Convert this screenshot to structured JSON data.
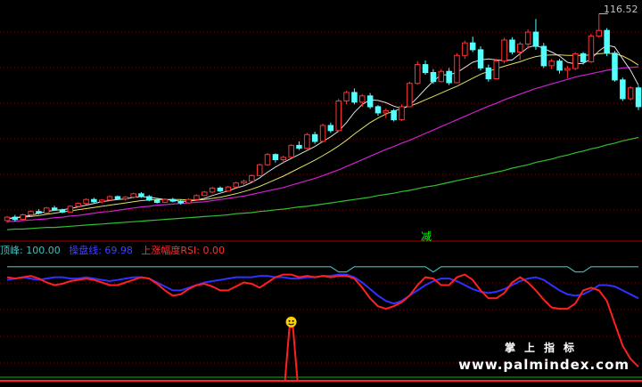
{
  "price_label": "116.52",
  "signal_label": "减",
  "legend": [
    {
      "text": "顶峰: 100.00",
      "color": "#40c0c0"
    },
    {
      "text": "操盘线: 69.98",
      "color": "#4040ff"
    },
    {
      "text": "上涨幅度RSI: 0.00",
      "color": "#ff3030"
    }
  ],
  "watermark": {
    "cn": "掌上指标",
    "url": "www.palmindex.com"
  },
  "chart_data": {
    "type": "candlestick",
    "upper": {
      "ylim": [
        78,
        118
      ],
      "price_marker": 116.52,
      "candles": [
        [
          80.2,
          81.0,
          79.8,
          80.8
        ],
        [
          80.8,
          81.2,
          80.0,
          80.4
        ],
        [
          80.4,
          81.4,
          80.2,
          81.2
        ],
        [
          81.2,
          82.0,
          80.9,
          81.8
        ],
        [
          81.8,
          82.2,
          81.3,
          81.5
        ],
        [
          81.5,
          82.6,
          81.4,
          82.4
        ],
        [
          82.4,
          82.8,
          81.9,
          82.1
        ],
        [
          82.1,
          82.3,
          81.5,
          81.7
        ],
        [
          81.7,
          82.9,
          81.6,
          82.7
        ],
        [
          82.7,
          83.4,
          82.5,
          83.2
        ],
        [
          83.2,
          84.1,
          83.0,
          83.9
        ],
        [
          83.9,
          84.2,
          83.3,
          83.5
        ],
        [
          83.5,
          84.0,
          83.2,
          83.8
        ],
        [
          83.8,
          84.6,
          83.7,
          84.4
        ],
        [
          84.4,
          84.6,
          83.8,
          84.0
        ],
        [
          84.0,
          84.5,
          83.7,
          84.3
        ],
        [
          84.3,
          85.1,
          84.1,
          84.9
        ],
        [
          84.9,
          85.2,
          84.2,
          84.4
        ],
        [
          84.4,
          84.7,
          83.6,
          83.8
        ],
        [
          83.8,
          84.0,
          83.2,
          83.4
        ],
        [
          83.4,
          84.1,
          83.3,
          83.9
        ],
        [
          83.9,
          84.2,
          83.4,
          83.6
        ],
        [
          83.6,
          83.9,
          83.0,
          83.3
        ],
        [
          83.3,
          84.1,
          83.2,
          83.9
        ],
        [
          83.9,
          84.8,
          83.8,
          84.6
        ],
        [
          84.6,
          85.4,
          84.5,
          85.2
        ],
        [
          85.2,
          86.1,
          85.0,
          85.9
        ],
        [
          85.9,
          86.2,
          85.2,
          85.4
        ],
        [
          85.4,
          86.3,
          85.3,
          86.1
        ],
        [
          86.1,
          87.0,
          85.9,
          86.8
        ],
        [
          86.8,
          87.4,
          86.5,
          87.1
        ],
        [
          87.1,
          88.3,
          87.0,
          88.1
        ],
        [
          88.1,
          90.2,
          88.0,
          90.0
        ],
        [
          90.0,
          92.1,
          89.8,
          91.8
        ],
        [
          91.8,
          92.0,
          90.4,
          90.9
        ],
        [
          90.9,
          91.6,
          90.2,
          91.3
        ],
        [
          91.3,
          93.6,
          91.1,
          93.4
        ],
        [
          93.4,
          94.1,
          92.6,
          92.9
        ],
        [
          92.9,
          95.6,
          92.7,
          95.3
        ],
        [
          95.3,
          95.8,
          93.7,
          94.1
        ],
        [
          94.1,
          97.2,
          93.9,
          96.9
        ],
        [
          96.9,
          97.4,
          95.6,
          96.0
        ],
        [
          96.0,
          101.6,
          95.8,
          101.2
        ],
        [
          101.2,
          103.0,
          100.6,
          102.7
        ],
        [
          102.7,
          103.4,
          100.6,
          101.0
        ],
        [
          101.0,
          102.4,
          100.2,
          102.1
        ],
        [
          102.1,
          102.6,
          99.8,
          100.2
        ],
        [
          100.2,
          100.5,
          98.6,
          99.1
        ],
        [
          99.1,
          99.9,
          98.2,
          99.5
        ],
        [
          99.5,
          99.8,
          97.6,
          97.9
        ],
        [
          97.9,
          100.6,
          97.7,
          100.2
        ],
        [
          100.2,
          104.6,
          100.1,
          104.3
        ],
        [
          104.3,
          108.2,
          104.1,
          107.6
        ],
        [
          107.6,
          108.3,
          105.8,
          106.2
        ],
        [
          106.2,
          106.8,
          104.2,
          104.6
        ],
        [
          104.6,
          106.8,
          104.5,
          106.4
        ],
        [
          106.4,
          107.0,
          104.0,
          104.4
        ],
        [
          104.4,
          109.6,
          104.3,
          109.2
        ],
        [
          109.2,
          111.8,
          108.6,
          111.4
        ],
        [
          111.4,
          112.5,
          109.8,
          110.2
        ],
        [
          110.2,
          110.8,
          106.6,
          107.0
        ],
        [
          107.0,
          107.6,
          104.6,
          105.1
        ],
        [
          105.1,
          108.6,
          105.0,
          108.2
        ],
        [
          108.2,
          112.3,
          107.8,
          111.9
        ],
        [
          111.9,
          112.4,
          109.4,
          109.8
        ],
        [
          109.8,
          111.6,
          108.4,
          111.2
        ],
        [
          111.2,
          113.8,
          110.4,
          113.3
        ],
        [
          113.3,
          115.6,
          110.2,
          110.8
        ],
        [
          110.8,
          111.4,
          107.0,
          107.4
        ],
        [
          107.4,
          108.6,
          106.8,
          108.2
        ],
        [
          108.2,
          108.6,
          106.0,
          106.6
        ],
        [
          106.6,
          107.4,
          105.2,
          106.9
        ],
        [
          106.9,
          109.8,
          106.6,
          109.5
        ],
        [
          109.5,
          109.8,
          107.6,
          108.1
        ],
        [
          108.1,
          113.0,
          107.9,
          112.6
        ],
        [
          112.6,
          116.5,
          112.3,
          113.6
        ],
        [
          113.6,
          114.0,
          109.1,
          109.6
        ],
        [
          109.6,
          110.0,
          104.6,
          104.9
        ],
        [
          104.9,
          105.3,
          101.2,
          101.6
        ],
        [
          101.6,
          103.8,
          101.3,
          103.5
        ],
        [
          103.5,
          103.9,
          99.6,
          100.2
        ]
      ],
      "ma5": [
        80.5,
        80.7,
        80.9,
        81.1,
        81.5,
        81.8,
        82.0,
        82.1,
        82.3,
        82.6,
        82.9,
        83.2,
        83.5,
        83.7,
        83.9,
        84.0,
        84.3,
        84.4,
        84.3,
        84.1,
        83.9,
        83.8,
        83.6,
        83.6,
        83.8,
        84.1,
        84.6,
        85.0,
        85.4,
        85.9,
        86.3,
        86.9,
        87.7,
        88.7,
        89.6,
        90.4,
        91.1,
        91.8,
        92.5,
        93.2,
        94.1,
        94.9,
        95.9,
        97.4,
        99.2,
        100.6,
        101.4,
        101.3,
        100.9,
        100.3,
        99.9,
        100.4,
        101.8,
        103.3,
        104.7,
        105.8,
        105.8,
        106.2,
        107.1,
        108.0,
        108.4,
        108.6,
        108.4,
        108.3,
        108.4,
        109.5,
        110.6,
        111.0,
        110.4,
        109.8,
        109.1,
        108.0,
        107.7,
        107.8,
        108.6,
        110.0,
        111.0,
        110.7,
        108.6,
        106.6,
        104.0
      ],
      "ma10": [
        80.6,
        80.7,
        80.8,
        80.9,
        81.1,
        81.3,
        81.5,
        81.7,
        81.9,
        82.1,
        82.3,
        82.5,
        82.7,
        82.9,
        83.1,
        83.3,
        83.5,
        83.7,
        83.8,
        83.9,
        83.9,
        83.9,
        83.9,
        83.8,
        83.8,
        83.9,
        84.1,
        84.3,
        84.6,
        84.9,
        85.3,
        85.7,
        86.2,
        86.8,
        87.4,
        88.0,
        88.7,
        89.4,
        90.1,
        90.8,
        91.6,
        92.4,
        93.3,
        94.3,
        95.4,
        96.4,
        97.4,
        98.2,
        98.9,
        99.4,
        99.9,
        100.3,
        100.8,
        101.4,
        102.0,
        102.6,
        103.2,
        103.8,
        104.5,
        105.2,
        105.9,
        106.4,
        106.9,
        107.3,
        107.7,
        108.1,
        108.6,
        109.0,
        109.2,
        109.3,
        109.3,
        109.2,
        109.2,
        109.2,
        109.3,
        109.5,
        109.6,
        109.5,
        109.1,
        108.4,
        107.5
      ],
      "ma20": [
        80.0,
        80.1,
        80.2,
        80.3,
        80.4,
        80.5,
        80.7,
        80.8,
        81.0,
        81.1,
        81.3,
        81.5,
        81.7,
        81.8,
        82.0,
        82.2,
        82.4,
        82.6,
        82.7,
        82.9,
        83.0,
        83.1,
        83.2,
        83.3,
        83.4,
        83.5,
        83.7,
        83.9,
        84.1,
        84.3,
        84.5,
        84.8,
        85.1,
        85.4,
        85.7,
        86.0,
        86.4,
        86.8,
        87.2,
        87.6,
        88.1,
        88.6,
        89.1,
        89.7,
        90.3,
        90.9,
        91.5,
        92.1,
        92.7,
        93.2,
        93.8,
        94.3,
        94.9,
        95.5,
        96.1,
        96.7,
        97.3,
        97.9,
        98.5,
        99.1,
        99.7,
        100.3,
        100.8,
        101.4,
        101.9,
        102.4,
        102.9,
        103.4,
        103.8,
        104.2,
        104.6,
        105.0,
        105.4,
        105.7,
        106.0,
        106.3,
        106.6,
        106.8,
        107.0,
        107.1,
        107.2
      ],
      "ma60": [
        78.6,
        78.7,
        78.7,
        78.8,
        78.9,
        79.0,
        79.0,
        79.1,
        79.2,
        79.3,
        79.4,
        79.5,
        79.6,
        79.7,
        79.8,
        79.9,
        80.0,
        80.1,
        80.2,
        80.3,
        80.4,
        80.5,
        80.6,
        80.7,
        80.8,
        80.9,
        81.0,
        81.1,
        81.2,
        81.4,
        81.5,
        81.6,
        81.8,
        81.9,
        82.1,
        82.2,
        82.4,
        82.6,
        82.7,
        82.9,
        83.1,
        83.3,
        83.5,
        83.7,
        83.9,
        84.1,
        84.3,
        84.6,
        84.8,
        85.0,
        85.3,
        85.5,
        85.8,
        86.1,
        86.3,
        86.6,
        86.9,
        87.2,
        87.5,
        87.8,
        88.1,
        88.4,
        88.7,
        89.0,
        89.4,
        89.7,
        90.0,
        90.4,
        90.7,
        91.0,
        91.4,
        91.7,
        92.1,
        92.4,
        92.8,
        93.1,
        93.5,
        93.8,
        94.2,
        94.5,
        94.8
      ]
    },
    "lower": {
      "ylim": [
        0,
        100
      ],
      "peak_line": [
        88,
        88,
        88,
        88,
        88,
        88,
        88,
        88,
        88,
        88,
        88,
        88,
        88,
        88,
        88,
        88,
        88,
        88,
        88,
        88,
        88,
        88,
        88,
        88,
        88,
        88,
        88,
        88,
        88,
        88,
        88,
        88,
        88,
        88,
        88,
        88,
        88,
        88,
        88,
        88,
        88,
        88,
        84,
        84,
        88,
        88,
        88,
        88,
        88,
        88,
        88,
        88,
        88,
        88,
        84,
        88,
        88,
        88,
        88,
        88,
        88,
        88,
        88,
        88,
        88,
        88,
        88,
        88,
        88,
        88,
        88,
        88,
        84,
        84,
        88,
        88,
        88,
        88,
        88,
        88,
        88
      ],
      "operate_line": [
        78,
        79,
        80,
        79,
        78,
        79,
        80,
        80,
        79,
        79,
        80,
        79,
        78,
        77,
        78,
        79,
        80,
        80,
        79,
        76,
        73,
        70,
        70,
        72,
        74,
        76,
        77,
        78,
        79,
        80,
        80,
        80,
        81,
        81,
        80,
        80,
        79,
        79,
        80,
        80,
        81,
        81,
        82,
        82,
        80,
        76,
        71,
        66,
        62,
        60,
        62,
        66,
        70,
        74,
        77,
        79,
        79,
        77,
        74,
        71,
        69,
        68,
        69,
        71,
        74,
        77,
        79,
        80,
        78,
        74,
        70,
        67,
        66,
        67,
        70,
        74,
        74,
        73,
        70,
        67,
        64
      ],
      "rsi_line": [
        80,
        79,
        80,
        81,
        79,
        76,
        74,
        75,
        77,
        78,
        79,
        78,
        76,
        74,
        74,
        76,
        78,
        80,
        79,
        75,
        70,
        66,
        67,
        71,
        74,
        75,
        73,
        70,
        70,
        73,
        76,
        75,
        72,
        76,
        80,
        82,
        82,
        80,
        81,
        80,
        81,
        80,
        81,
        81,
        79,
        72,
        64,
        58,
        56,
        58,
        61,
        66,
        74,
        80,
        79,
        74,
        74,
        80,
        82,
        78,
        70,
        64,
        64,
        68,
        76,
        80,
        76,
        70,
        63,
        57,
        56,
        56,
        60,
        70,
        72,
        70,
        62,
        45,
        28,
        18,
        12
      ],
      "signal_spike_index": 36,
      "signal_spike_value": 42
    }
  }
}
